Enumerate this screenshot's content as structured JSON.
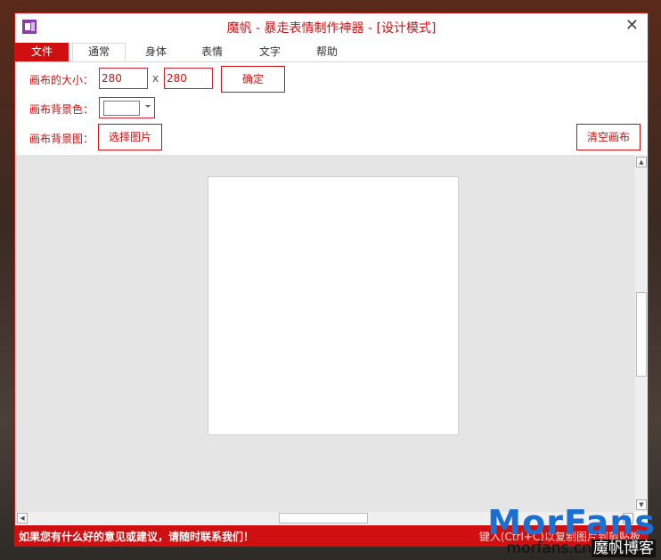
{
  "window": {
    "title": "魔帆 - 暴走表情制作神器 - [设计模式]",
    "close_symbol": "✕",
    "accent": "#d01010"
  },
  "tabs": [
    "文件",
    "通常",
    "身体",
    "表情",
    "文字",
    "帮助"
  ],
  "active_tab": "通常",
  "ribbon": {
    "size_label": "画布的大小：",
    "width_value": "280",
    "times": "x",
    "height_value": "280",
    "confirm_button": "确定",
    "bg_color_label": "画布背景色：",
    "bg_image_label": "画布背景图：",
    "choose_image_button": "选择图片",
    "clear_canvas_button": "清空画布"
  },
  "scrollbar": {
    "up": "▲",
    "down": "▼",
    "left": "◀",
    "right": "▶"
  },
  "status": {
    "left": "如果您有什么好的意见或建议，请随时联系我们！",
    "right": "键入(Ctrl+C)以复制图片到剪贴板"
  },
  "watermark": {
    "logo": "MorFans",
    "domain": "morfans.cn",
    "blog": "魔帆博客"
  }
}
